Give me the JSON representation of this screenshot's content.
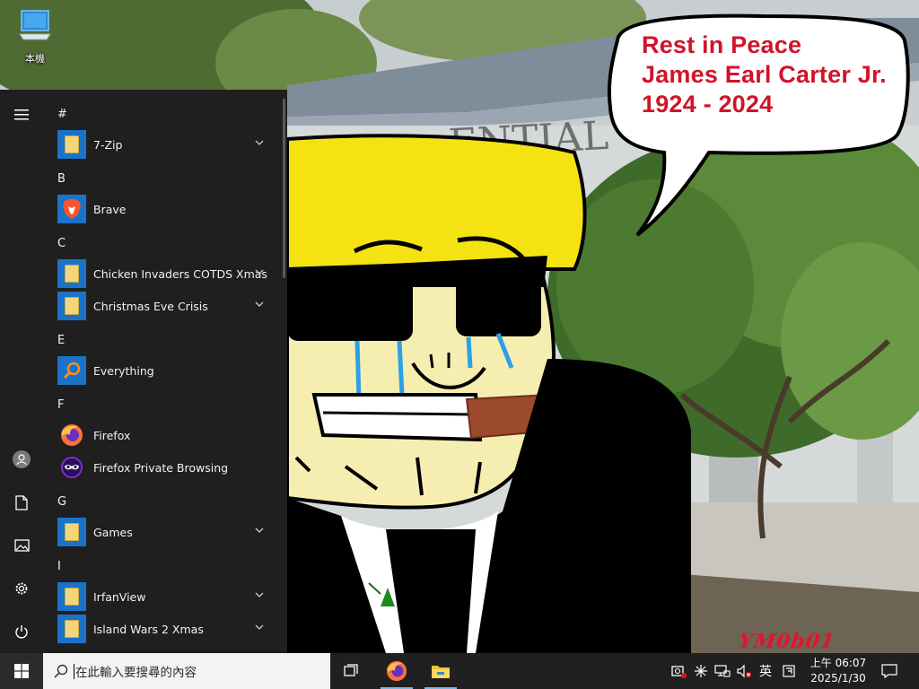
{
  "desktop": {
    "icons": [
      {
        "label": "本機",
        "icon": "this-pc-icon"
      }
    ],
    "wallpaper": {
      "building_sign": "ENTIAL",
      "speech_bubble": [
        "Rest in Peace",
        "James Earl Carter Jr.",
        "1924 - 2024"
      ],
      "watermark": "YM0b01"
    }
  },
  "start_menu": {
    "rail": [
      {
        "name": "expand",
        "icon": "hamburger-icon"
      },
      {
        "name": "user",
        "icon": "user-avatar-icon"
      },
      {
        "name": "documents",
        "icon": "document-icon"
      },
      {
        "name": "pictures",
        "icon": "picture-icon"
      },
      {
        "name": "settings",
        "icon": "gear-icon"
      },
      {
        "name": "power",
        "icon": "power-icon"
      }
    ],
    "groups": [
      {
        "letter": "#",
        "apps": [
          {
            "name": "7-Zip",
            "type": "folder",
            "expandable": true
          }
        ]
      },
      {
        "letter": "B",
        "apps": [
          {
            "name": "Brave",
            "type": "brave",
            "expandable": false
          }
        ]
      },
      {
        "letter": "C",
        "apps": [
          {
            "name": "Chicken Invaders COTDS Xmas",
            "type": "folder",
            "expandable": true
          },
          {
            "name": "Christmas Eve Crisis",
            "type": "folder",
            "expandable": true
          }
        ]
      },
      {
        "letter": "E",
        "apps": [
          {
            "name": "Everything",
            "type": "everything",
            "expandable": false
          }
        ]
      },
      {
        "letter": "F",
        "apps": [
          {
            "name": "Firefox",
            "type": "firefox",
            "expandable": false
          },
          {
            "name": "Firefox Private Browsing",
            "type": "firefox-private",
            "expandable": false
          }
        ]
      },
      {
        "letter": "G",
        "apps": [
          {
            "name": "Games",
            "type": "folder",
            "expandable": true
          }
        ]
      },
      {
        "letter": "I",
        "apps": [
          {
            "name": "IrfanView",
            "type": "folder",
            "expandable": true
          },
          {
            "name": "Island Wars 2 Xmas",
            "type": "folder",
            "expandable": true
          }
        ]
      }
    ]
  },
  "taskbar": {
    "search_placeholder": "在此輸入要搜尋的內容",
    "pinned": [
      {
        "name": "task-view",
        "icon": "task-view-icon"
      },
      {
        "name": "firefox",
        "icon": "firefox-icon"
      },
      {
        "name": "file-explorer",
        "icon": "folder-icon"
      }
    ],
    "tray": {
      "icons": [
        "meet-now-icon",
        "network-star-icon",
        "network-icon",
        "volume-muted-icon"
      ],
      "ime": "英",
      "ime_mode": "input-mode-icon",
      "time": "上午 06:07",
      "date": "2025/1/30",
      "notification_icon": "notification-icon"
    }
  },
  "colors": {
    "accent": "#1a73c9",
    "start_bg": "#1f1f1f",
    "taskbar_bg": "#202020",
    "bubble_text": "#d0142a"
  }
}
